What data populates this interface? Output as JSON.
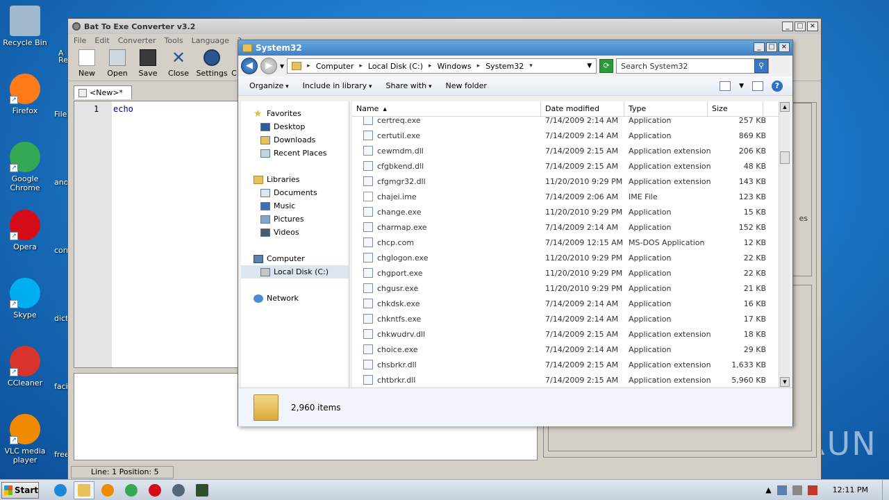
{
  "desktop": {
    "icons": [
      {
        "label": "Recycle Bin",
        "icon": "recycle-bin-icon",
        "color": "#9fb8cc"
      },
      {
        "label": "Firefox",
        "icon": "firefox-icon",
        "color": "#ff7a1a"
      },
      {
        "label": "Google Chrome",
        "icon": "chrome-icon",
        "color": "#34a853"
      },
      {
        "label": "Opera",
        "icon": "opera-icon",
        "color": "#d50d19"
      },
      {
        "label": "Skype",
        "icon": "skype-icon",
        "color": "#00aff0"
      },
      {
        "label": "CCleaner",
        "icon": "ccleaner-icon",
        "color": "#d9342b"
      },
      {
        "label": "VLC media player",
        "icon": "vlc-icon",
        "color": "#f08a00"
      }
    ],
    "partial_labels": [
      "A",
      "Re",
      "File",
      "ano",
      "corr",
      "dicti",
      "faci",
      "free"
    ]
  },
  "bat_window": {
    "title": "Bat To Exe Converter v3.2",
    "menu": [
      "File",
      "Edit",
      "Converter",
      "Tools",
      "Language",
      "?"
    ],
    "toolbar": [
      "New",
      "Open",
      "Save",
      "Close",
      "Settings",
      "C"
    ],
    "tab_label": "<New>*",
    "line_number": "1",
    "code": "echo",
    "status": "Line: 1  Position: 5",
    "right_panel_text": "es"
  },
  "explorer": {
    "title": "System32",
    "breadcrumb": [
      "Computer",
      "Local Disk (C:)",
      "Windows",
      "System32"
    ],
    "search_placeholder": "Search System32",
    "commands": [
      "Organize",
      "Include in library",
      "Share with",
      "New folder"
    ],
    "nav": {
      "favorites": "Favorites",
      "favorites_items": [
        "Desktop",
        "Downloads",
        "Recent Places"
      ],
      "libraries": "Libraries",
      "libraries_items": [
        "Documents",
        "Music",
        "Pictures",
        "Videos"
      ],
      "computer": "Computer",
      "computer_items": [
        "Local Disk (C:)"
      ],
      "network": "Network"
    },
    "columns": [
      "Name",
      "Date modified",
      "Type",
      "Size"
    ],
    "files": [
      {
        "name": "certreq.exe",
        "date": "7/14/2009 2:14 AM",
        "type": "Application",
        "size": "257 KB"
      },
      {
        "name": "certutil.exe",
        "date": "7/14/2009 2:14 AM",
        "type": "Application",
        "size": "869 KB"
      },
      {
        "name": "cewmdm.dll",
        "date": "7/14/2009 2:15 AM",
        "type": "Application extension",
        "size": "206 KB"
      },
      {
        "name": "cfgbkend.dll",
        "date": "7/14/2009 2:15 AM",
        "type": "Application extension",
        "size": "48 KB"
      },
      {
        "name": "cfgmgr32.dll",
        "date": "11/20/2010 9:29 PM",
        "type": "Application extension",
        "size": "143 KB"
      },
      {
        "name": "chajei.ime",
        "date": "7/14/2009 2:06 AM",
        "type": "IME File",
        "size": "123 KB"
      },
      {
        "name": "change.exe",
        "date": "11/20/2010 9:29 PM",
        "type": "Application",
        "size": "15 KB"
      },
      {
        "name": "charmap.exe",
        "date": "7/14/2009 2:14 AM",
        "type": "Application",
        "size": "152 KB"
      },
      {
        "name": "chcp.com",
        "date": "7/14/2009 12:15 AM",
        "type": "MS-DOS Application",
        "size": "12 KB"
      },
      {
        "name": "chglogon.exe",
        "date": "11/20/2010 9:29 PM",
        "type": "Application",
        "size": "22 KB"
      },
      {
        "name": "chgport.exe",
        "date": "11/20/2010 9:29 PM",
        "type": "Application",
        "size": "22 KB"
      },
      {
        "name": "chgusr.exe",
        "date": "11/20/2010 9:29 PM",
        "type": "Application",
        "size": "21 KB"
      },
      {
        "name": "chkdsk.exe",
        "date": "7/14/2009 2:14 AM",
        "type": "Application",
        "size": "16 KB"
      },
      {
        "name": "chkntfs.exe",
        "date": "7/14/2009 2:14 AM",
        "type": "Application",
        "size": "17 KB"
      },
      {
        "name": "chkwudrv.dll",
        "date": "7/14/2009 2:15 AM",
        "type": "Application extension",
        "size": "18 KB"
      },
      {
        "name": "choice.exe",
        "date": "7/14/2009 2:14 AM",
        "type": "Application",
        "size": "29 KB"
      },
      {
        "name": "chsbrkr.dll",
        "date": "7/14/2009 2:15 AM",
        "type": "Application extension",
        "size": "1,633 KB"
      },
      {
        "name": "chtbrkr.dll",
        "date": "7/14/2009 2:15 AM",
        "type": "Application extension",
        "size": "5,960 KB"
      }
    ],
    "item_count": "2,960 items"
  },
  "taskbar": {
    "start_label": "Start",
    "pinned": [
      {
        "icon": "internet-explorer-icon",
        "color": "#1e88d8"
      },
      {
        "icon": "explorer-icon",
        "color": "#e8c15a"
      },
      {
        "icon": "media-player-icon",
        "color": "#f08a00"
      },
      {
        "icon": "chrome-icon",
        "color": "#34a853"
      },
      {
        "icon": "opera-icon",
        "color": "#d50d19"
      },
      {
        "icon": "bat-to-exe-icon",
        "color": "#556677"
      },
      {
        "icon": "terminal-icon",
        "color": "#2f4f2f"
      }
    ],
    "clock": "12:11 PM"
  },
  "watermark": "ANY RUN"
}
